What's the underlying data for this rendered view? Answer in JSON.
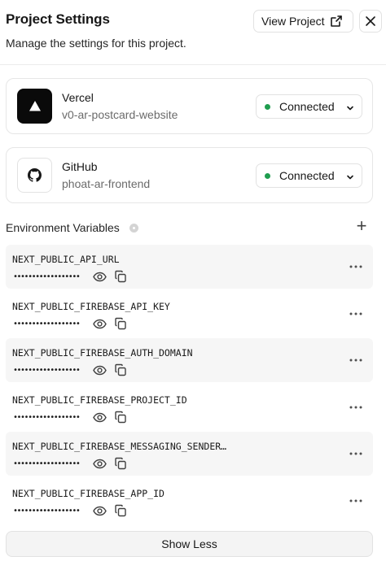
{
  "header": {
    "title": "Project Settings",
    "subtitle": "Manage the settings for this project.",
    "view_project_label": "View Project"
  },
  "integrations": [
    {
      "name": "Vercel",
      "project": "v0-ar-postcard-website",
      "status": "Connected",
      "icon": "vercel-triangle-icon"
    },
    {
      "name": "GitHub",
      "project": "phoat-ar-frontend",
      "status": "Connected",
      "icon": "github-icon"
    }
  ],
  "env": {
    "title": "Environment Variables",
    "masked_value": "••••••••••••••••••",
    "variables": [
      {
        "key": "NEXT_PUBLIC_API_URL"
      },
      {
        "key": "NEXT_PUBLIC_FIREBASE_API_KEY"
      },
      {
        "key": "NEXT_PUBLIC_FIREBASE_AUTH_DOMAIN"
      },
      {
        "key": "NEXT_PUBLIC_FIREBASE_PROJECT_ID"
      },
      {
        "key": "NEXT_PUBLIC_FIREBASE_MESSAGING_SENDER…"
      },
      {
        "key": "NEXT_PUBLIC_FIREBASE_APP_ID"
      }
    ]
  },
  "footer": {
    "show_less_label": "Show Less"
  },
  "colors": {
    "connected_dot": "#1f9d4f",
    "row_shade": "#f6f6f6"
  }
}
